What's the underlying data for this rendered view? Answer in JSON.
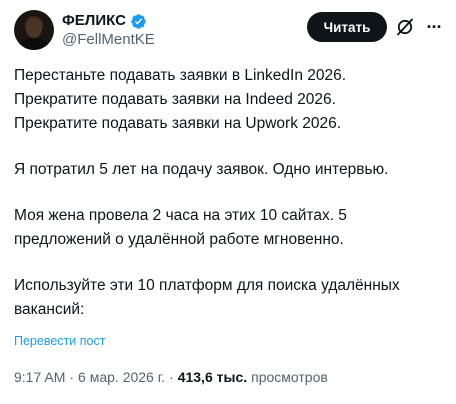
{
  "author": {
    "display_name": "ФЕЛИКС",
    "handle": "@FellMentKE",
    "verified_color": "#1d9bf0"
  },
  "actions": {
    "follow_label": "Читать",
    "grok_icon": "grok-slash-icon",
    "more_icon": "more-dots-icon"
  },
  "tweet": {
    "lines": [
      "Перестаньте подавать заявки в LinkedIn 2026.",
      "Прекратите подавать заявки на Indeed 2026.",
      "Прекратите подавать заявки на Upwork 2026.",
      "Я потратил 5 лет на подачу заявок. Одно интервью.",
      "Моя жена провела 2 часа на этих 10 сайтах. 5",
      "предложений о удалённой работе мгновенно.",
      "Используйте эти 10 платформ для поиска удалённых",
      "вакансий:"
    ],
    "translate_label": "Перевести пост"
  },
  "meta": {
    "time": "9:17 AM",
    "date": "6 мар. 2026 г.",
    "views_count": "413,6 тыс.",
    "views_label": "просмотров",
    "separator": "·"
  },
  "colors": {
    "text": "#0f1419",
    "secondary": "#536471",
    "link": "#1d9bf0",
    "button_bg": "#0f1419"
  }
}
